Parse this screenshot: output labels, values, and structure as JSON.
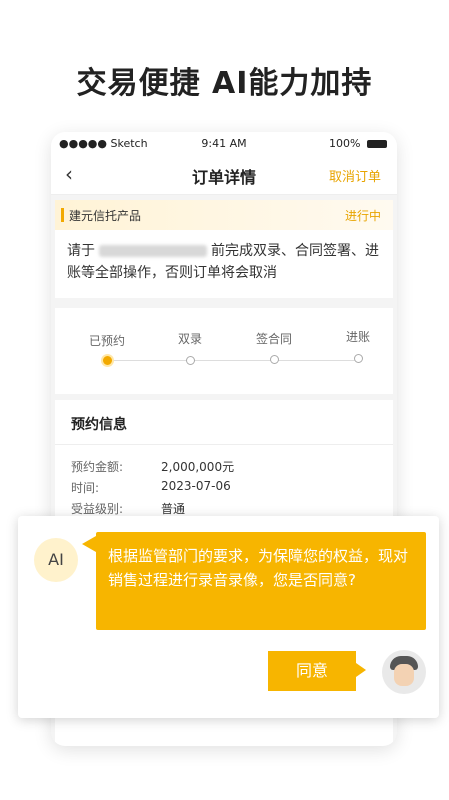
{
  "headline": "交易便捷 AI能力加持",
  "status_bar": {
    "carrier": "●●●●● Sketch",
    "time": "9:41 AM",
    "battery": "100%"
  },
  "nav": {
    "title": "订单详情",
    "cancel_label": "取消订单"
  },
  "product_card": {
    "name": "建元信托产品",
    "status": "进行中",
    "message_prefix": "请于",
    "message_suffix": "前完成双录、合同签署、进账等全部操作，否则订单将会取消"
  },
  "progress": {
    "steps": [
      "已预约",
      "双录",
      "签合同",
      "进账"
    ],
    "current_step": 0
  },
  "reservation": {
    "title": "预约信息",
    "rows": [
      {
        "label": "预约金额:",
        "value": "2,000,000元"
      },
      {
        "label": "时间:",
        "value": "2023-07-06"
      },
      {
        "label": "受益级别:",
        "value": "普通"
      }
    ]
  },
  "ai_chat": {
    "avatar_label": "AI",
    "message": "根据监管部门的要求，为保障您的权益，现对销售过程进行录音录像，您是否同意?",
    "agree_label": "同意"
  }
}
